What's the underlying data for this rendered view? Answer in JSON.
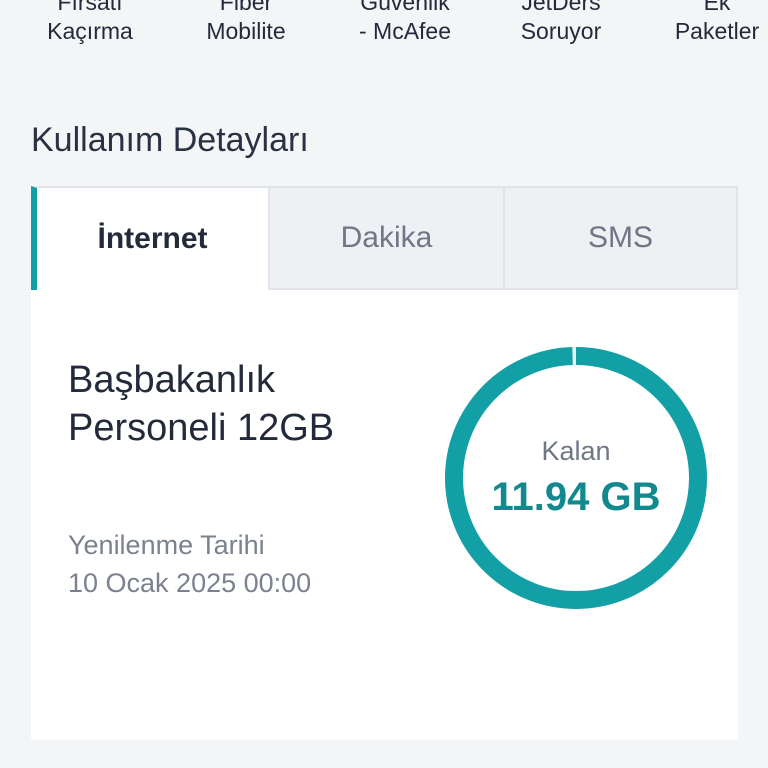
{
  "shortcuts": [
    {
      "line1": "Fırsatı",
      "line2": "Kaçırma"
    },
    {
      "line1": "Fiber",
      "line2": "Mobilite"
    },
    {
      "line1": "Güvenlik",
      "line2": "- McAfee"
    },
    {
      "line1": "JetDers",
      "line2": "Soruyor"
    },
    {
      "line1": "Ek",
      "line2": "Paketler"
    }
  ],
  "section": {
    "title": "Kullanım Detayları"
  },
  "tabs": [
    {
      "label": "İnternet",
      "active": true
    },
    {
      "label": "Dakika",
      "active": false
    },
    {
      "label": "SMS",
      "active": false
    }
  ],
  "usage": {
    "package_line1": "Başbakanlık",
    "package_line2": "Personeli 12GB",
    "renew_label": "Yenilenme Tarihi",
    "renew_date": "10 Ocak 2025 00:00",
    "remaining_label": "Kalan",
    "remaining_value": "11.94 GB",
    "remaining_fraction": 0.995
  },
  "colors": {
    "accent": "#12a0a6",
    "value_text": "#12898f",
    "gauge_track": "#e6f3f4"
  }
}
